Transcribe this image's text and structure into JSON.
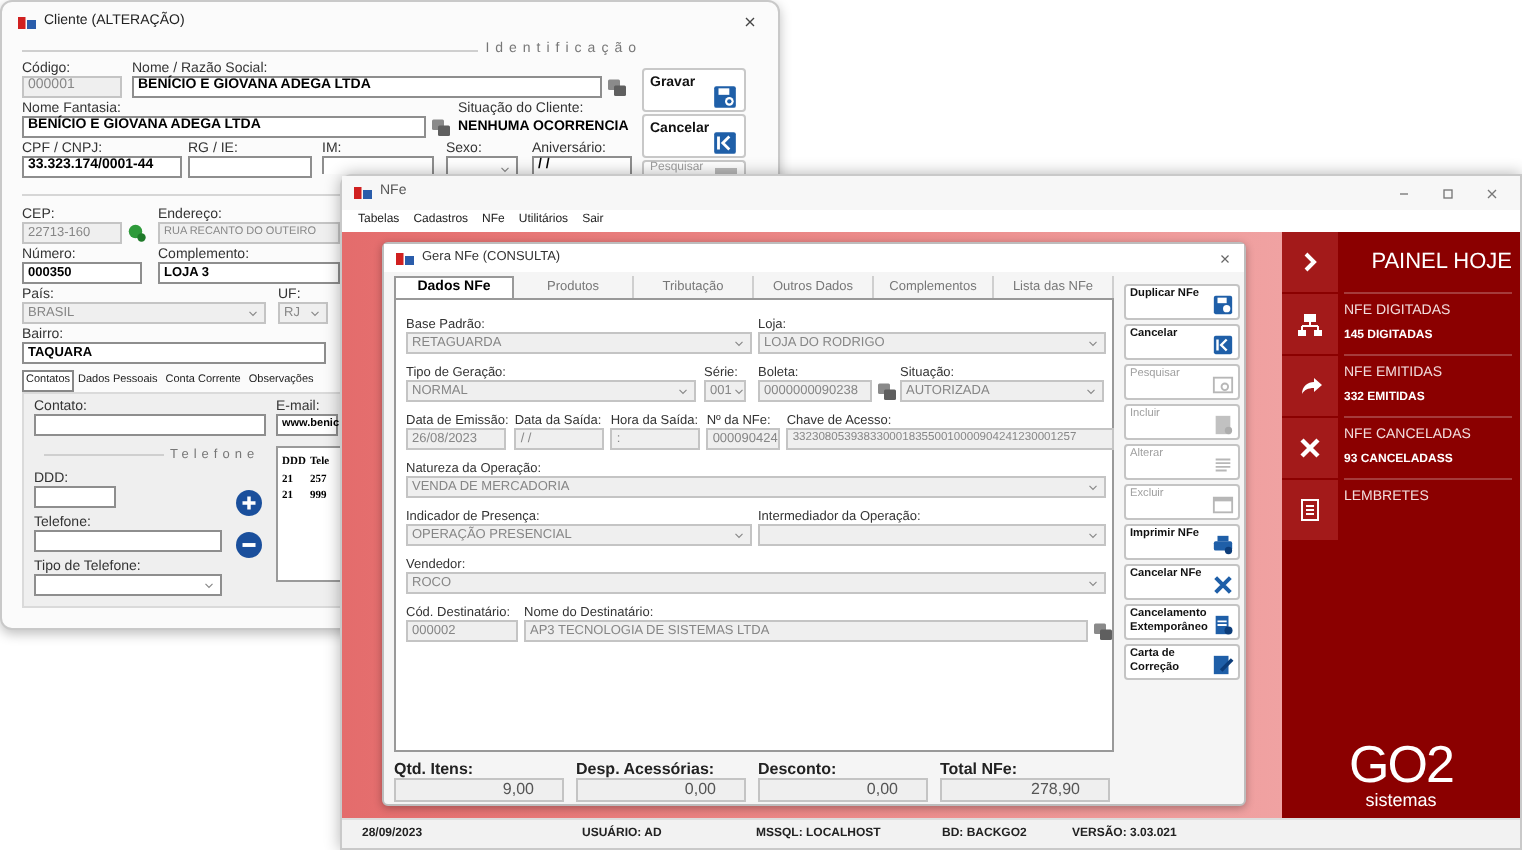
{
  "cliente_window": {
    "title": "Cliente (ALTERAÇÃO)",
    "section_title": "Identificação",
    "identification_rows": [
      [
        {
          "label": "Código:",
          "value": "000001",
          "kind": "text",
          "disabled": true
        },
        {
          "label": "Nome / Razão Social:",
          "value": "BENÍCIO E GIOVANA ADEGA LTDA",
          "kind": "lookup",
          "disabled": false
        }
      ],
      [
        {
          "label": "Nome Fantasia:",
          "value": "BENÍCIO E GIOVANA ADEGA LTDA",
          "kind": "lookup",
          "disabled": false
        },
        {
          "label": "Situação do Cliente:",
          "value": "NENHUMA OCORRENCIA",
          "kind": "readout"
        }
      ],
      [
        {
          "label": "CPF / CNPJ:",
          "value": "33.323.174/0001-44",
          "kind": "text",
          "disabled": false
        },
        {
          "label": "RG / IE:",
          "kind": "text",
          "disabled": false
        },
        {
          "label": "IM:",
          "kind": "text",
          "disabled": false
        },
        {
          "label": "Sexo:",
          "kind": "dropdown",
          "disabled": false
        },
        {
          "label": "Aniversário:",
          "value": " /  /",
          "kind": "text",
          "disabled": false
        }
      ]
    ],
    "buttons": [
      {
        "label": "Gravar",
        "disabled": false
      },
      {
        "label": "Cancelar",
        "disabled": false
      },
      {
        "label": "Pesquisar",
        "disabled": true
      }
    ],
    "address_rows": [
      [
        {
          "label": "CEP:",
          "value": "22713-160",
          "kind": "lookup",
          "disabled": true
        },
        {
          "label": "Endereço:",
          "value": "RUA RECANTO DO OUTEIRO",
          "kind": "text",
          "disabled": true
        }
      ],
      [
        {
          "label": "Número:",
          "value": "000350",
          "kind": "text",
          "disabled": false
        },
        {
          "label": "Complemento:",
          "value": "LOJA 3",
          "kind": "text",
          "disabled": false
        }
      ],
      [
        {
          "label": "País:",
          "value": "BRASIL",
          "kind": "dropdown",
          "disabled": true
        },
        {
          "label": "UF:",
          "value": "RJ",
          "kind": "dropdown",
          "disabled": true
        }
      ],
      [
        {
          "label": "Bairro:",
          "value": "TAQUARA",
          "kind": "text",
          "disabled": false
        }
      ]
    ],
    "tabs": [
      {
        "label": "Contatos",
        "selected": true
      },
      {
        "label": "Dados Pessoais",
        "selected": false
      },
      {
        "label": "Conta Corrente",
        "selected": false
      },
      {
        "label": "Observações",
        "selected": false
      }
    ],
    "contact_fields": [
      {
        "label": "Contato:",
        "kind": "text",
        "disabled": false
      },
      {
        "label": "E-mail:",
        "value": "www.benic",
        "kind": "text",
        "disabled": false
      }
    ],
    "phone_section_title": "Telefone",
    "phone_fields": [
      {
        "label": "DDD:",
        "kind": "text",
        "disabled": false
      },
      {
        "label": "Telefone:",
        "kind": "text",
        "disabled": false
      },
      {
        "label": "Tipo de Telefone:",
        "kind": "dropdown",
        "disabled": false
      }
    ],
    "phone_list": {
      "columns": [
        "DDD",
        "Tele"
      ],
      "rows": [
        [
          "21",
          "257"
        ],
        [
          "21",
          "999"
        ]
      ]
    }
  },
  "nfe_window": {
    "title": "NFe",
    "menu": [
      "Tabelas",
      "Cadastros",
      "NFe",
      "Utilitários",
      "Sair"
    ],
    "form_window": {
      "title": "Gera NFe (CONSULTA)",
      "tabs": [
        {
          "label": "Dados NFe",
          "selected": true
        },
        {
          "label": "Produtos",
          "selected": false
        },
        {
          "label": "Tributação",
          "selected": false
        },
        {
          "label": "Outros Dados",
          "selected": false
        },
        {
          "label": "Complementos",
          "selected": false
        },
        {
          "label": "Lista das NFe",
          "selected": false
        }
      ],
      "fields": [
        {
          "label": "Base Padrão:",
          "value": "RETAGUARDA",
          "kind": "dropdown",
          "disabled": true
        },
        {
          "label": "Loja:",
          "value": "LOJA DO RODRIGO",
          "kind": "dropdown",
          "disabled": true
        },
        {
          "label": "Tipo de Geração:",
          "value": "NORMAL",
          "kind": "dropdown",
          "disabled": true
        },
        {
          "label": "Série:",
          "value": "001",
          "kind": "dropdown",
          "disabled": true
        },
        {
          "label": "Boleta:",
          "value": "0000000090238",
          "kind": "lookup",
          "disabled": true
        },
        {
          "label": "Situação:",
          "value": "AUTORIZADA",
          "kind": "dropdown",
          "disabled": true
        },
        {
          "label": "Data de Emissão:",
          "value": "26/08/2023",
          "kind": "text",
          "disabled": true
        },
        {
          "label": "Data da Saída:",
          "value": " /  /",
          "kind": "text",
          "disabled": true
        },
        {
          "label": "Hora da Saída:",
          "value": " : ",
          "kind": "text",
          "disabled": true
        },
        {
          "label": "Nº da NFe:",
          "value": "000090424",
          "kind": "text",
          "disabled": true
        },
        {
          "label": "Chave de Acesso:",
          "value": "33230805393833000183550010000904241230001257",
          "kind": "text",
          "disabled": true
        },
        {
          "label": "Natureza da Operação:",
          "value": "VENDA DE MERCADORIA",
          "kind": "dropdown",
          "disabled": true
        },
        {
          "label": "Indicador de Presença:",
          "value": "OPERAÇÃO PRESENCIAL",
          "kind": "dropdown",
          "disabled": true
        },
        {
          "label": "Intermediador da Operação:",
          "kind": "dropdown",
          "disabled": true
        },
        {
          "label": "Vendedor:",
          "value": "ROCO",
          "kind": "dropdown",
          "disabled": true
        },
        {
          "label": "Cód. Destinatário:",
          "value": "000002",
          "kind": "text",
          "disabled": true
        },
        {
          "label": "Nome do Destinatário:",
          "value": "AP3 TECNOLOGIA DE SISTEMAS LTDA",
          "kind": "lookup",
          "disabled": true
        }
      ],
      "totals": [
        {
          "label": "Qtd. Itens:",
          "value": "9,00"
        },
        {
          "label": "Desp. Acessórias:",
          "value": "0,00"
        },
        {
          "label": "Desconto:",
          "value": "0,00"
        },
        {
          "label": "Total NFe:",
          "value": "278,90"
        }
      ],
      "buttons": [
        {
          "label": "Duplicar NFe",
          "disabled": false
        },
        {
          "label": "Cancelar",
          "disabled": false
        },
        {
          "label": "Pesquisar",
          "disabled": true
        },
        {
          "label": "Incluir",
          "disabled": true
        },
        {
          "label": "Alterar",
          "disabled": true
        },
        {
          "label": "Excluir",
          "disabled": true
        },
        {
          "label": "Imprimir NFe",
          "disabled": false
        },
        {
          "label": "Cancelar NFe",
          "disabled": false
        },
        {
          "label": "Cancelamento Extemporâneo",
          "disabled": false
        },
        {
          "label": "Carta de Correção",
          "disabled": false
        }
      ]
    },
    "panel": {
      "title": "PAINEL HOJE",
      "items": [
        {
          "title": "NFE DIGITADAS",
          "subtitle": "145 DIGITADAS"
        },
        {
          "title": "NFE EMITIDAS",
          "subtitle": "332 EMITIDAS"
        },
        {
          "title": "NFE CANCELADAS",
          "subtitle": "93 CANCELADASS"
        },
        {
          "title": "LEMBRETES"
        }
      ],
      "logo": {
        "mark": "GO2",
        "tagline": "sistemas"
      }
    },
    "status_bar": [
      "28/09/2023",
      "USUÁRIO: AD",
      "MSSQL: LOCALHOST",
      "BD: BACKGO2",
      "VERSÃO: 3.03.021"
    ]
  }
}
